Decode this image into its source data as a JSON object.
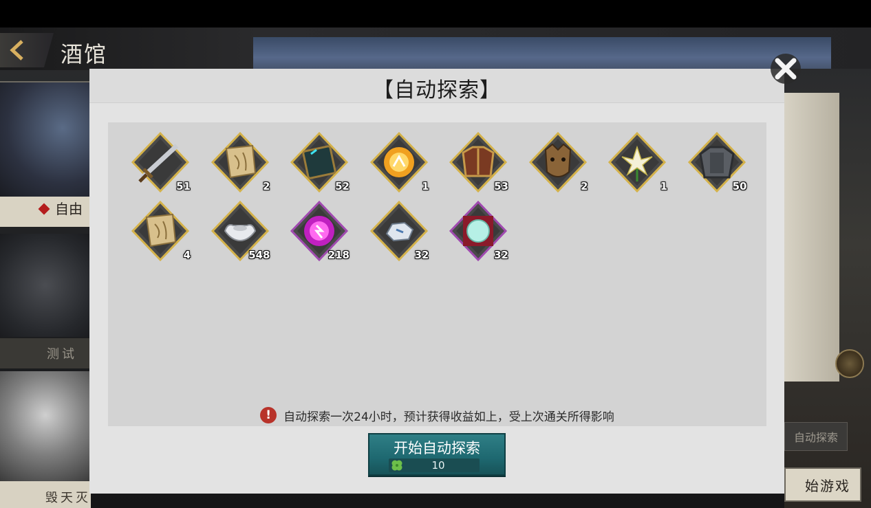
{
  "app": {
    "title": "酒馆",
    "back_icon": "back-chevron-icon"
  },
  "background": {
    "side_tabs": [
      {
        "label": "自由",
        "state": "selected"
      },
      {
        "label": "测试",
        "state": "normal"
      },
      {
        "label": "毁天灭",
        "state": "locked"
      }
    ],
    "right_buttons": {
      "auto_explore": "自动探索",
      "start_game": "始游戏"
    }
  },
  "modal": {
    "title": "【自动探索】",
    "close_icon": "close-x-icon",
    "rewards": [
      {
        "icon": "sword-icon",
        "count": "51",
        "frame": "gold"
      },
      {
        "icon": "scroll-fragment-icon",
        "count": "2",
        "frame": "gold"
      },
      {
        "icon": "skill-book-icon",
        "count": "52",
        "frame": "gold"
      },
      {
        "icon": "golden-orb-icon",
        "count": "1",
        "frame": "gold"
      },
      {
        "icon": "armor-icon",
        "count": "53",
        "frame": "gold"
      },
      {
        "icon": "demon-mask-icon",
        "count": "2",
        "frame": "gold"
      },
      {
        "icon": "lily-flower-icon",
        "count": "1",
        "frame": "gold"
      },
      {
        "icon": "iron-armor-icon",
        "count": "50",
        "frame": "gold"
      },
      {
        "icon": "scroll-fragment-icon",
        "count": "4",
        "frame": "gold"
      },
      {
        "icon": "silver-ingot-icon",
        "count": "548",
        "frame": "gold"
      },
      {
        "icon": "purple-orb-icon",
        "count": "218",
        "frame": "purple"
      },
      {
        "icon": "ore-stone-icon",
        "count": "32",
        "frame": "gold"
      },
      {
        "icon": "jade-stone-icon",
        "count": "32",
        "frame": "purple"
      }
    ],
    "notice": {
      "icon": "warning-icon",
      "mark": "!",
      "text": "自动探索一次24小时，预计获得收益如上，受上次通关所得影响"
    },
    "start_button": {
      "label": "开始自动探索",
      "cost_icon": "clover-icon",
      "cost": "10"
    }
  },
  "colors": {
    "modal_bg": "#e3e3e3",
    "items_bg": "#d3d3d3",
    "button_teal": "#1e6870",
    "warning_red": "#b8332a",
    "gold_frame": "#d4b24a",
    "purple_frame": "#a04ab0"
  }
}
